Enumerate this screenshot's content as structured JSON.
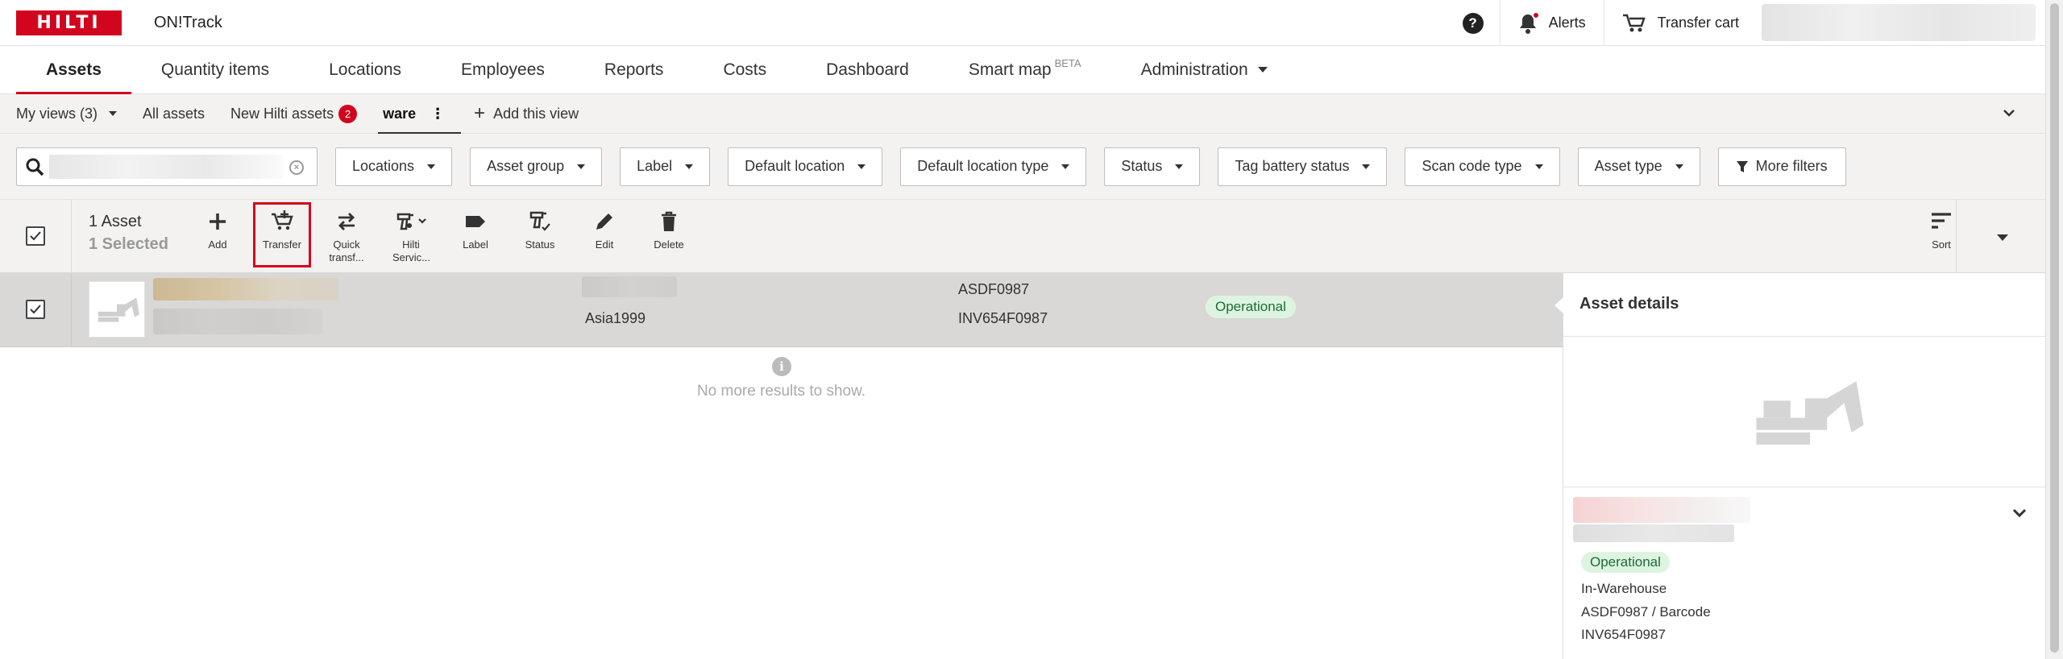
{
  "header": {
    "logo_text": "HILTI",
    "app_name": "ON!Track",
    "help_label": "?",
    "alerts_label": "Alerts",
    "transfer_cart_label": "Transfer cart"
  },
  "nav": {
    "tabs": [
      {
        "label": "Assets"
      },
      {
        "label": "Quantity items"
      },
      {
        "label": "Locations"
      },
      {
        "label": "Employees"
      },
      {
        "label": "Reports"
      },
      {
        "label": "Costs"
      },
      {
        "label": "Dashboard"
      },
      {
        "label": "Smart map",
        "superscript": "BETA"
      },
      {
        "label": "Administration"
      }
    ]
  },
  "views": {
    "my_views_label": "My views (3)",
    "all_assets_label": "All assets",
    "new_hilti_label": "New Hilti assets",
    "new_hilti_badge": "2",
    "active_view_label": "ware",
    "add_view_label": "Add this view"
  },
  "filters": {
    "search_placeholder": "",
    "buttons": [
      "Locations",
      "Asset group",
      "Label",
      "Default location",
      "Default location type",
      "Status",
      "Tag battery status",
      "Scan code type",
      "Asset type"
    ],
    "more_filters_label": "More filters"
  },
  "actions": {
    "asset_count": "1 Asset",
    "selected_count": "1 Selected",
    "items": [
      {
        "label": "Add"
      },
      {
        "label": "Transfer"
      },
      {
        "label": "Quick transf..."
      },
      {
        "label": "Hilti Servic..."
      },
      {
        "label": "Label"
      },
      {
        "label": "Status"
      },
      {
        "label": "Edit"
      },
      {
        "label": "Delete"
      }
    ],
    "sort_label": "Sort"
  },
  "table": {
    "row": {
      "location": "Asia1999",
      "scan_code": "ASDF0987",
      "inventory": "INV654F0987",
      "status": "Operational"
    },
    "empty_message": "No more results to show."
  },
  "details": {
    "title": "Asset details",
    "status": "Operational",
    "location_type": "In-Warehouse",
    "scan_code": "ASDF0987 / Barcode",
    "inventory": "INV654F0987"
  },
  "colors": {
    "brand_red": "#d2051e",
    "operational_bg": "#ddf4e1",
    "operational_text": "#1c6b34",
    "selected_row": "#d9d8d6"
  }
}
